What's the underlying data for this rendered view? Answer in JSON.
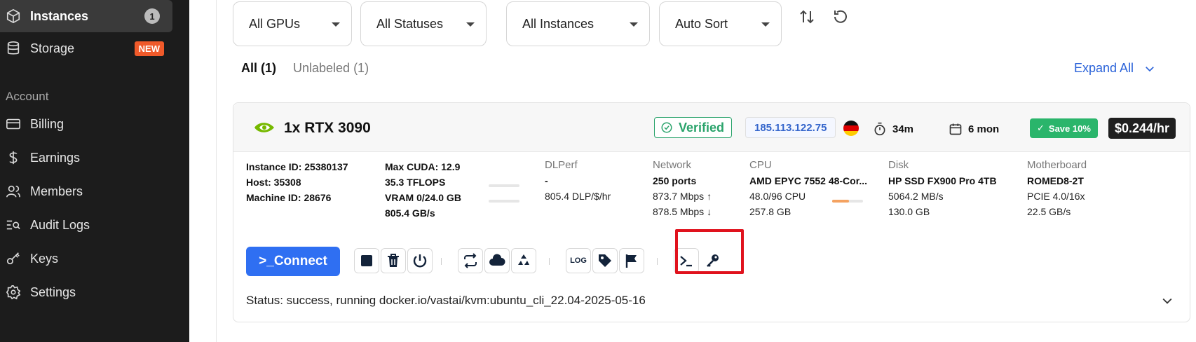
{
  "sidebar": {
    "items": [
      {
        "label": "Instances",
        "icon": "cube-icon",
        "badge": "1"
      },
      {
        "label": "Storage",
        "icon": "database-icon",
        "badge": "NEW"
      },
      {
        "label": "Billing",
        "icon": "card-icon"
      },
      {
        "label": "Earnings",
        "icon": "dollar-icon"
      },
      {
        "label": "Members",
        "icon": "users-icon"
      },
      {
        "label": "Audit Logs",
        "icon": "search-list-icon"
      },
      {
        "label": "Keys",
        "icon": "key-icon"
      },
      {
        "label": "Settings",
        "icon": "gear-icon"
      }
    ],
    "section_label": "Account"
  },
  "filters": {
    "gpus": "All GPUs",
    "statuses": "All Statuses",
    "instances": "All Instances",
    "sort": "Auto Sort"
  },
  "tabs": {
    "all": "All (1)",
    "unlabeled": "Unlabeled (1)",
    "expand_all": "Expand All"
  },
  "instance": {
    "gpu": "1x RTX 3090",
    "verified": "Verified",
    "ip": "185.113.122.75",
    "uptime": "34m",
    "duration": "6 mon",
    "save": "Save 10%",
    "price": "$0.244/hr",
    "instance_id": "Instance ID: 25380137",
    "host": "Host: 35308",
    "machine_id": "Machine ID: 28676",
    "max_cuda": "Max CUDA: 12.9",
    "tflops": "35.3 TFLOPS",
    "vram": "VRAM 0/24.0 GB",
    "bandwidth": "805.4 GB/s",
    "dlperf_label": "DLPerf",
    "dlperf_value": "-",
    "dlperf_per_dollar": "805.4 DLP/$/hr",
    "network_label": "Network",
    "ports": "250 ports",
    "upload": "873.7 Mbps",
    "download": "878.5 Mbps",
    "cpu_label": "CPU",
    "cpu_name": "AMD EPYC 7552 48-Cor...",
    "cpu_count": "48.0/96 CPU",
    "ram": "257.8 GB",
    "cpu_usage_fraction": 0.55,
    "disk_label": "Disk",
    "disk_name": "HP SSD FX900 Pro 4TB",
    "disk_speed": "5064.2 MB/s",
    "disk_size": "130.0 GB",
    "mobo_label": "Motherboard",
    "mobo_name": "ROMED8-2T",
    "pcie": "PCIE 4.0/16x",
    "pcie_bw": "22.5 GB/s",
    "connect": ">_Connect",
    "log": "LOG",
    "status": "Status: success, running docker.io/vastai/kvm:ubuntu_cli_22.04-2025-05-16"
  },
  "colors": {
    "accent": "#2f6ff2",
    "verified": "#2aa36b",
    "highlight": "#e0121d"
  }
}
